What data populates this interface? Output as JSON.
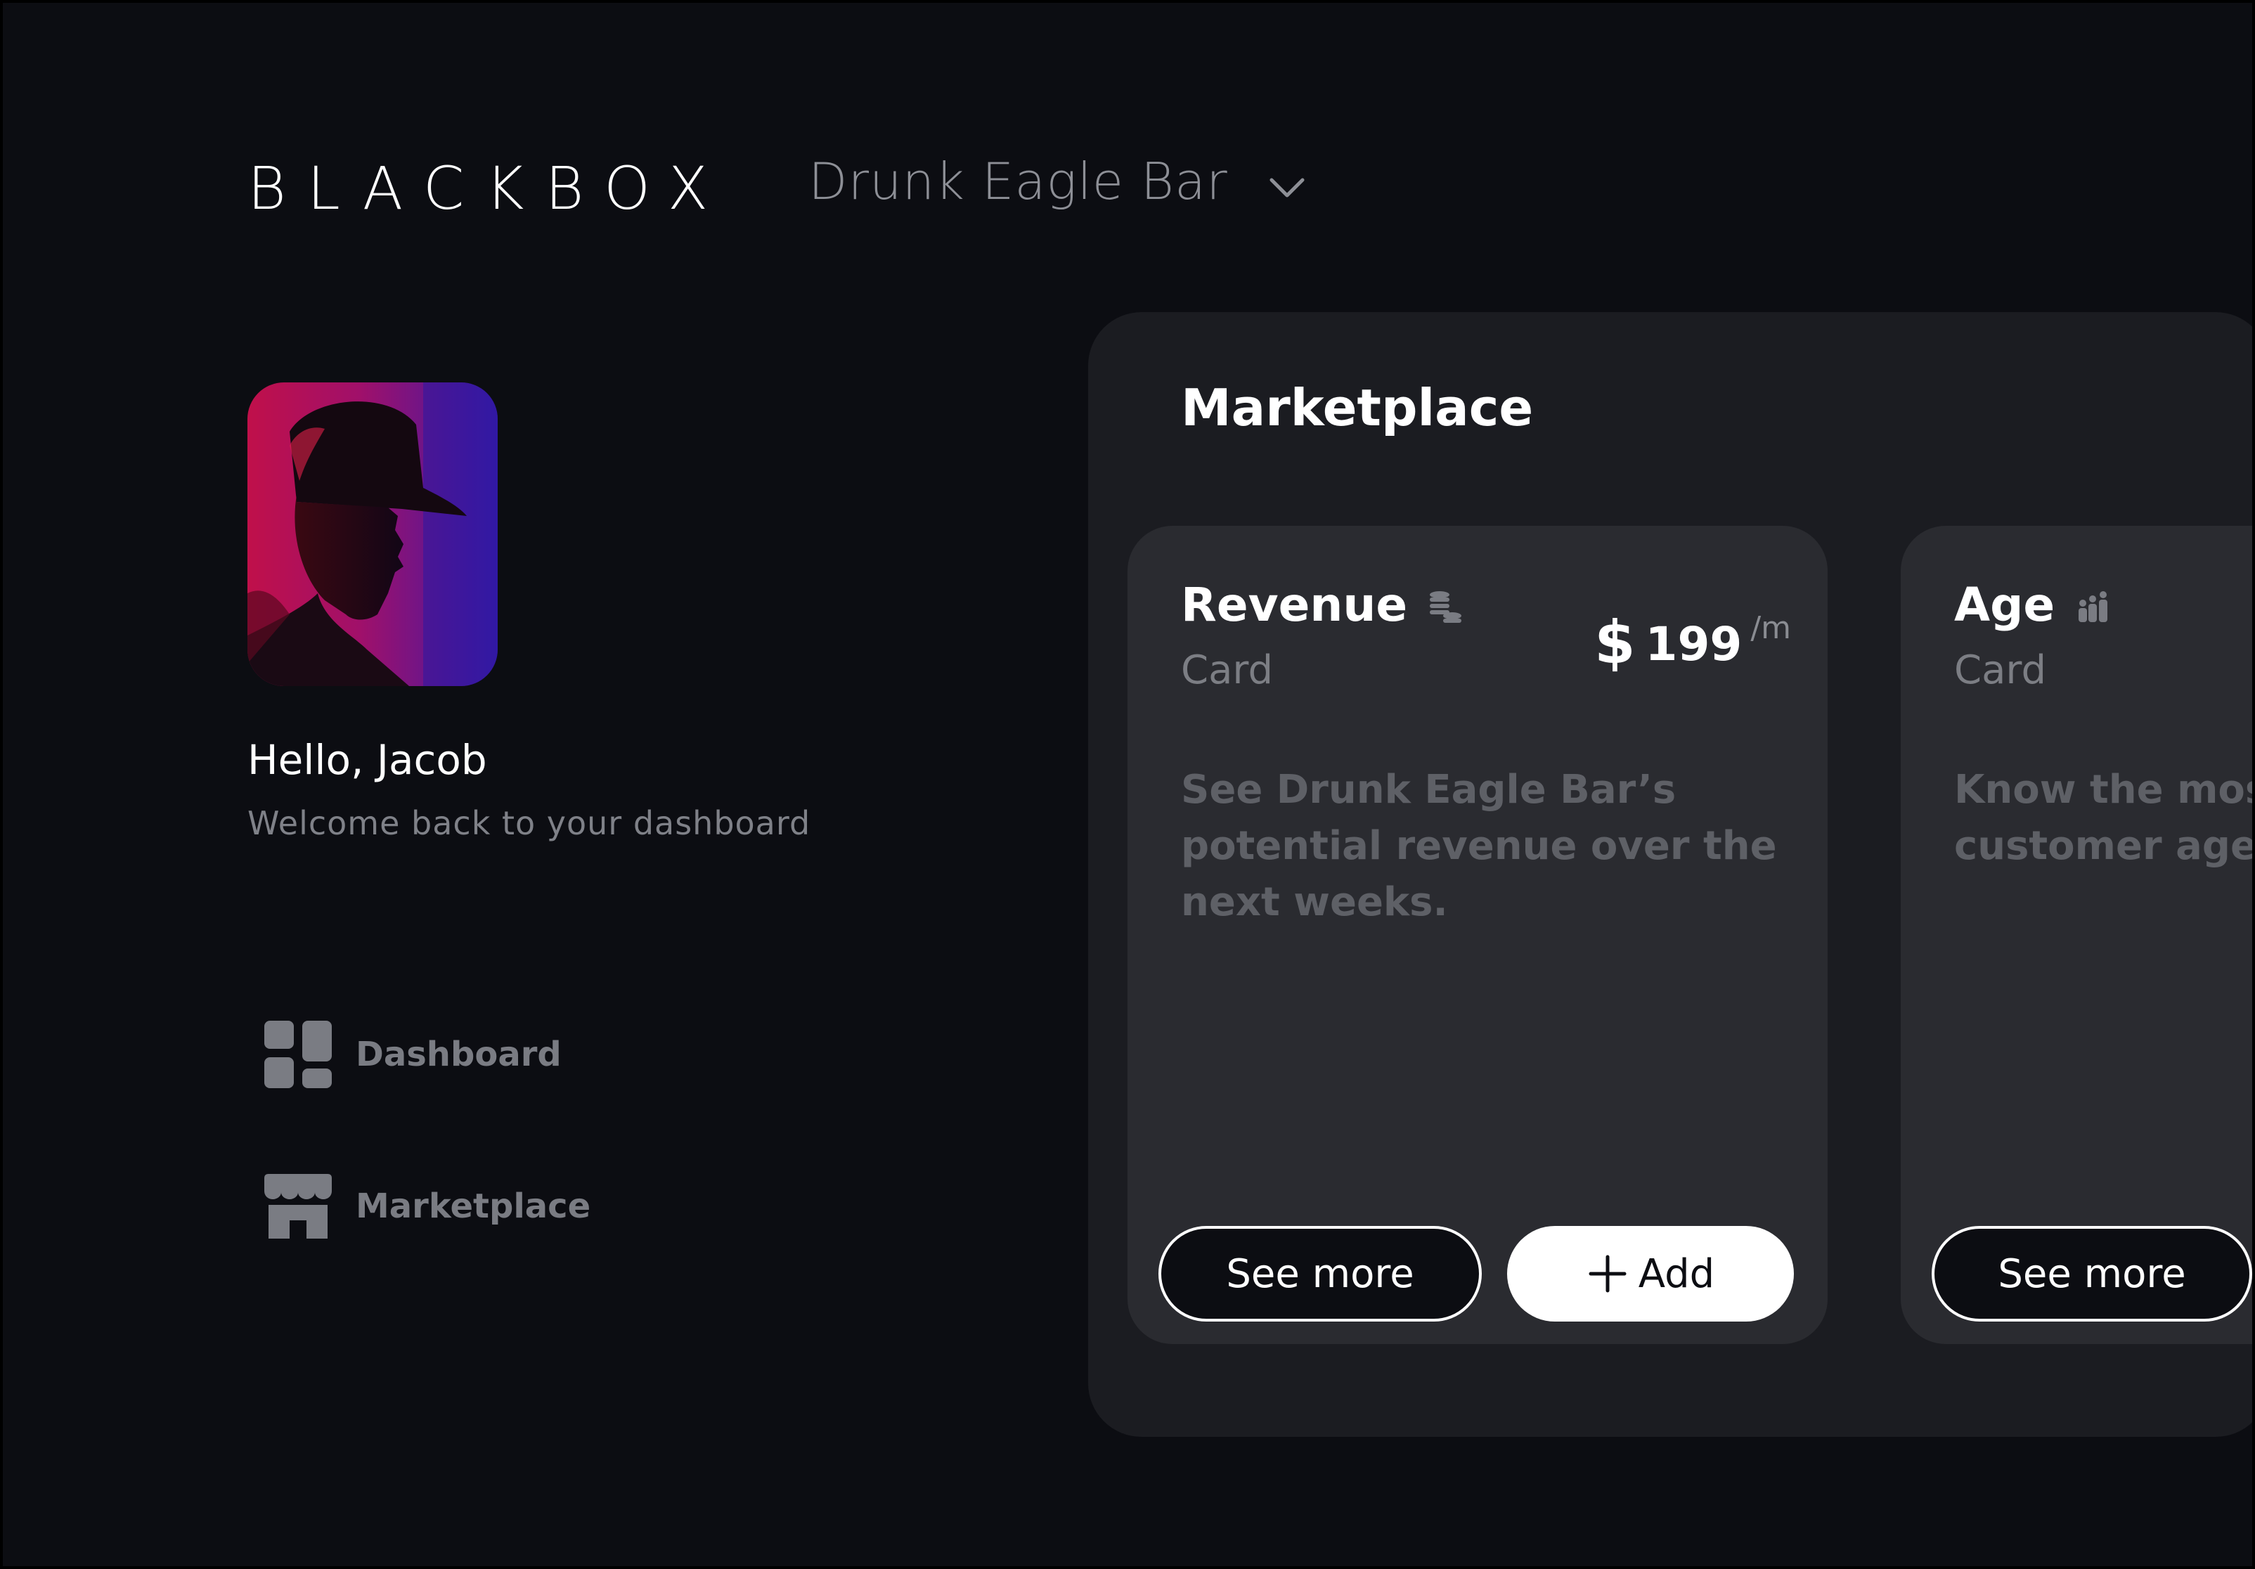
{
  "header": {
    "logo": "BLACKBOX",
    "venue_selector": {
      "label": "Drunk Eagle Bar",
      "icon": "chevron-down-icon"
    }
  },
  "profile": {
    "greeting": "Hello, Jacob",
    "subtitle": "Welcome back to your dashboard"
  },
  "sidebar": {
    "items": [
      {
        "label": "Dashboard",
        "icon": "dashboard-grid-icon"
      },
      {
        "label": "Marketplace",
        "icon": "storefront-icon"
      }
    ]
  },
  "marketplace": {
    "title": "Marketplace",
    "cards": [
      {
        "title": "Revenue",
        "icon": "coins-icon",
        "subtitle": "Card",
        "price": {
          "currency": "$",
          "amount": "199",
          "period": "/m"
        },
        "description": "See Drunk Eagle Bar’s potential revenue over the next weeks.",
        "see_more_label": "See more",
        "add_label": "Add"
      },
      {
        "title": "Age",
        "icon": "people-icon",
        "subtitle": "Card",
        "description_lines": [
          "Know the most",
          "customer age"
        ],
        "see_more_label": "See more"
      }
    ]
  },
  "colors": {
    "background": "#0c0d12",
    "panel": "#1b1c21",
    "card": "#2a2b30",
    "muted_text": "#7c7e84",
    "accent_button": "#ffffff"
  }
}
